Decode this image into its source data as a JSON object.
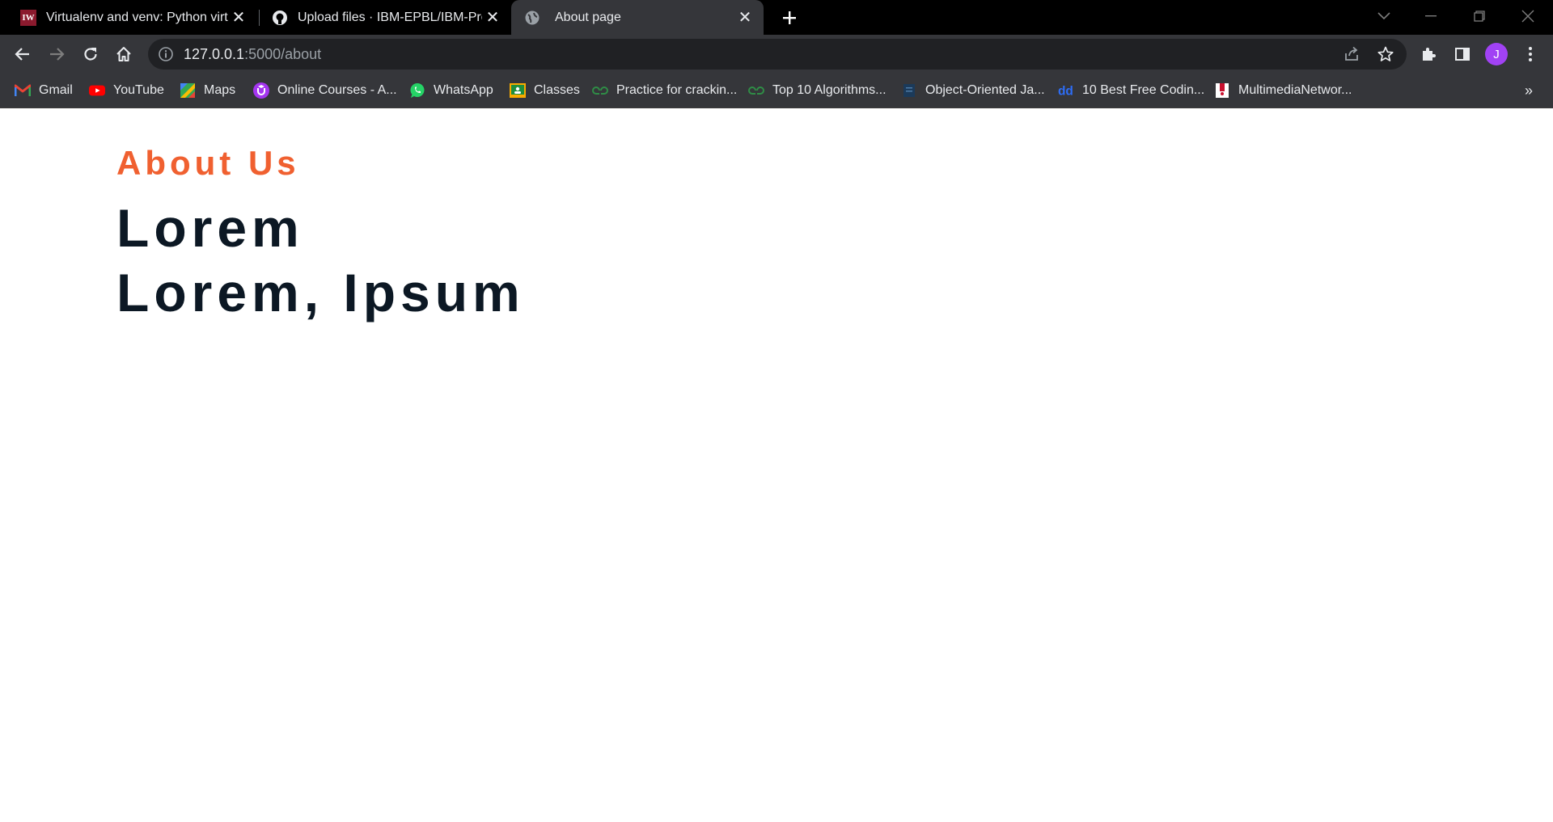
{
  "tabs": [
    {
      "title": "Virtualenv and venv: Python virtu",
      "icon": "iw-favicon-icon",
      "active": false
    },
    {
      "title": "Upload files · IBM-EPBL/IBM-Proj",
      "icon": "github-icon",
      "active": false
    },
    {
      "title": "About page",
      "icon": "globe-icon",
      "active": true
    }
  ],
  "iw_badge": "IW",
  "omnibox": {
    "host": "127.0.0.1",
    "path": ":5000/about"
  },
  "profile": {
    "initial": "J",
    "color": "#a142f4"
  },
  "bookmarks": [
    {
      "label": "Gmail",
      "icon": "gmail-icon"
    },
    {
      "label": "YouTube",
      "icon": "youtube-icon"
    },
    {
      "label": "Maps",
      "icon": "maps-icon"
    },
    {
      "label": "Online Courses - A...",
      "icon": "udemy-icon"
    },
    {
      "label": "WhatsApp",
      "icon": "whatsapp-icon"
    },
    {
      "label": "Classes",
      "icon": "classroom-icon"
    },
    {
      "label": "Practice for crackin...",
      "icon": "gfg-icon"
    },
    {
      "label": "Top 10 Algorithms...",
      "icon": "gfg-icon"
    },
    {
      "label": "Object-Oriented Ja...",
      "icon": "doc-icon"
    },
    {
      "label": "10 Best Free Codin...",
      "icon": "dd-icon"
    },
    {
      "label": "MultimediaNetwor...",
      "icon": "multimedia-icon"
    }
  ],
  "page": {
    "label": "About Us",
    "headline_line1": "Lorem",
    "headline_line2": "Lorem, Ipsum"
  },
  "colors": {
    "accent": "#f06030",
    "heading": "#0c1824",
    "chrome_dark": "#000000",
    "chrome_toolbar": "#35363a"
  }
}
